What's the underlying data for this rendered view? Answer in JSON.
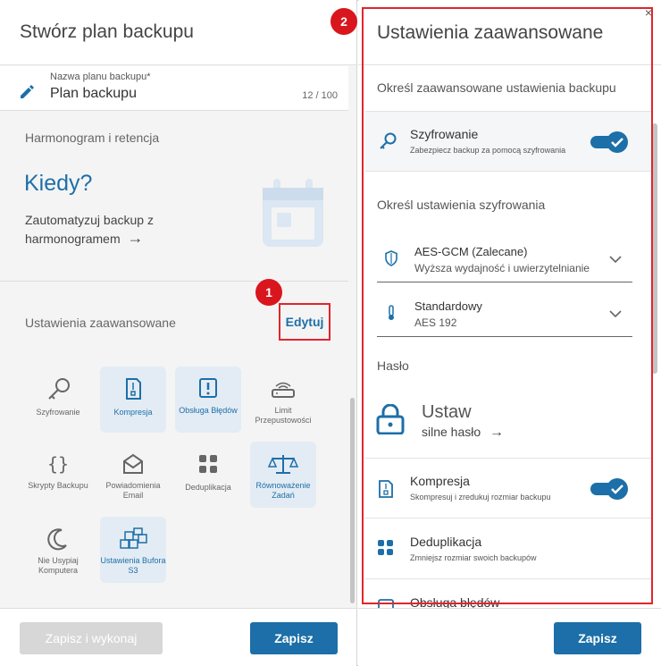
{
  "left": {
    "title": "Stwórz plan backupu",
    "name_field": {
      "label": "Nazwa planu backupu*",
      "value": "Plan backupu",
      "counter": "12 / 100"
    },
    "schedule": {
      "section_title": "Harmonogram i retencja",
      "headline": "Kiedy?",
      "desc": "Zautomatyzuj backup z harmonogramem",
      "arrow": "→"
    },
    "advanced": {
      "section_title": "Ustawienia zaawansowane",
      "edit_label": "Edytuj",
      "badge": "1"
    },
    "tiles": [
      {
        "label": "Szyfrowanie",
        "icon": "key-icon",
        "active": false
      },
      {
        "label": "Kompresja",
        "icon": "compress-file-icon",
        "active": true
      },
      {
        "label": "Obsługa Błędów",
        "icon": "alert-icon",
        "active": true
      },
      {
        "label": "Limit Przepustowości",
        "icon": "router-icon",
        "active": false
      },
      {
        "label": "Skrypty Backupu",
        "icon": "braces-icon",
        "active": false
      },
      {
        "label": "Powiadomienia Email",
        "icon": "envelope-icon",
        "active": false
      },
      {
        "label": "Deduplikacja",
        "icon": "grid-icon",
        "active": false
      },
      {
        "label": "Równoważenie Zadań",
        "icon": "scales-icon",
        "active": true
      },
      {
        "label": "Nie Usypiaj Komputera",
        "icon": "moon-icon",
        "active": false
      },
      {
        "label": "Ustawienia Bufora S3",
        "icon": "cubes-icon",
        "active": true
      }
    ],
    "footer": {
      "secondary": "Zapisz i wykonaj",
      "primary": "Zapisz"
    }
  },
  "right": {
    "title": "Ustawienia zaawansowane",
    "badge": "2",
    "close": "×",
    "section1": "Określ zaawansowane ustawienia backupu",
    "encryption": {
      "title": "Szyfrowanie",
      "sub": "Zabezpiecz backup za pomocą szyfrowania",
      "enabled": true
    },
    "section2": "Określ ustawienia szyfrowania",
    "algorithm": {
      "main": "AES-GCM (Zalecane)",
      "sub": "Wyższa wydajność i uwierzytelnianie"
    },
    "strength": {
      "main": "Standardowy",
      "sub": "AES 192"
    },
    "password": {
      "label": "Hasło",
      "action": "Ustaw",
      "sub": "silne hasło",
      "arrow": "→"
    },
    "compression": {
      "title": "Kompresja",
      "sub": "Skompresuj i zredukuj rozmiar backupu",
      "enabled": true
    },
    "dedup": {
      "title": "Deduplikacja",
      "sub": "Zmniejsz rozmiar swoich backupów"
    },
    "errors": {
      "title": "Obsługa błędów"
    },
    "footer": {
      "primary": "Zapisz"
    }
  },
  "colors": {
    "accent": "#1c6fa8",
    "highlight": "#e0262b",
    "tile_active": "#e3ecf4"
  }
}
